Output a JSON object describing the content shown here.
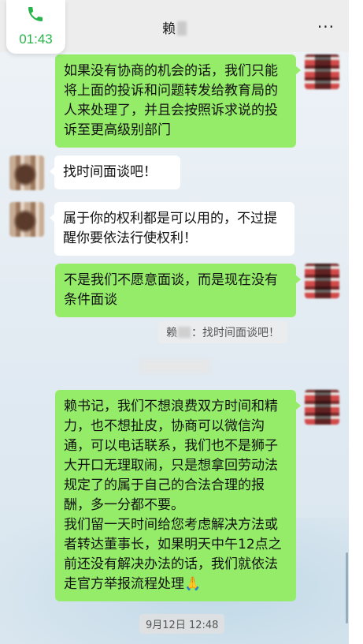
{
  "call_chip": {
    "time": "01:43",
    "icon": "phone-icon",
    "accent": "#28b44a"
  },
  "header": {
    "title": "赖",
    "more": "···"
  },
  "messages": [
    {
      "side": "right",
      "text": "如果没有协商的机会的话，我们只能将上面的投诉和问题转发给教育局的人来处理了，并且会按照诉求说的投诉至更高级别部门"
    },
    {
      "side": "left",
      "text": "找时间面谈吧！"
    },
    {
      "side": "left",
      "text": "属于你的权利都是可以用的，不过提醒你要依法行使权利！"
    },
    {
      "side": "right",
      "text": "不是我们不愿意面谈，而是现在没有条件面谈"
    },
    {
      "side": "right",
      "text": "赖书记，我们不想浪费双方时间和精力，也不想扯皮，协商可以微信沟通，可以电话联系，我们也不是狮子大开口无理取闹，只是想拿回劳动法规定了的属于自己的合法合理的报酬，多一分都不要。\n我们留一天时间给您考虑解决方法或者转达董事长，如果明天中午12点之前还没有解决办法的话，我们就依法走官方举报流程处理🙏"
    }
  ],
  "quote": {
    "name": "赖",
    "text": "：找时间面谈吧！"
  },
  "timestamp": "9月12日 12:48",
  "colors": {
    "sent_bubble": "#95ec69",
    "received_bubble": "#ffffff",
    "header_bg": "#ededed"
  }
}
